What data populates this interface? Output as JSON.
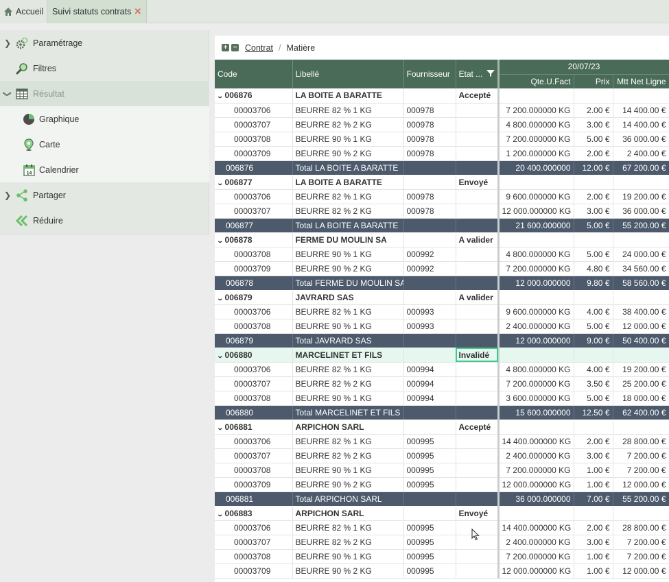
{
  "tabs": {
    "home": "Accueil",
    "active": "Suivi statuts contrats"
  },
  "sidebar": {
    "parametrage": "Paramétrage",
    "filtres": "Filtres",
    "resultat": "Résultat",
    "graphique": "Graphique",
    "carte": "Carte",
    "calendrier": "Calendrier",
    "partager": "Partager",
    "reduire": "Réduire"
  },
  "breadcrumb": {
    "contrat": "Contrat",
    "separator": "/",
    "matiere": "Matière"
  },
  "grid": {
    "headers": {
      "code": "Code",
      "libelle": "Libellé",
      "fournisseur": "Fournisseur",
      "etat": "Etat ...",
      "date": "20/07/23",
      "qte": "Qte.U.Fact",
      "prix": "Prix",
      "mtt": "Mtt Net Ligne"
    },
    "rows": [
      {
        "type": "grp",
        "code": "006876",
        "libelle": "LA BOITE A BARATTE",
        "fournisseur": "",
        "etat": "Accepté",
        "qte": "",
        "prix": "",
        "mtt": ""
      },
      {
        "type": "det",
        "code": "00003706",
        "libelle": "BEURRE 82 % 1 KG",
        "fournisseur": "000978",
        "etat": "",
        "qte": "7 200.000000 KG",
        "prix": "2.00 €",
        "mtt": "14 400.00 €"
      },
      {
        "type": "det",
        "code": "00003707",
        "libelle": "BEURRE 82 % 2 KG",
        "fournisseur": "000978",
        "etat": "",
        "qte": "4 800.000000 KG",
        "prix": "3.00 €",
        "mtt": "14 400.00 €"
      },
      {
        "type": "det",
        "code": "00003708",
        "libelle": "BEURRE 90 % 1 KG",
        "fournisseur": "000978",
        "etat": "",
        "qte": "7 200.000000 KG",
        "prix": "5.00 €",
        "mtt": "36 000.00 €"
      },
      {
        "type": "det",
        "code": "00003709",
        "libelle": "BEURRE 90 % 2 KG",
        "fournisseur": "000978",
        "etat": "",
        "qte": "1 200.000000 KG",
        "prix": "2.00 €",
        "mtt": "2 400.00 €"
      },
      {
        "type": "tot",
        "code": "006876",
        "libelle": "Total LA BOITE A BARATTE",
        "fournisseur": "",
        "etat": "",
        "qte": "20 400.000000",
        "prix": "12.00 €",
        "mtt": "67 200.00 €"
      },
      {
        "type": "grp",
        "code": "006877",
        "libelle": "LA BOITE A BARATTE",
        "fournisseur": "",
        "etat": "Envoyé",
        "qte": "",
        "prix": "",
        "mtt": ""
      },
      {
        "type": "det",
        "code": "00003706",
        "libelle": "BEURRE 82 % 1 KG",
        "fournisseur": "000978",
        "etat": "",
        "qte": "9 600.000000 KG",
        "prix": "2.00 €",
        "mtt": "19 200.00 €"
      },
      {
        "type": "det",
        "code": "00003707",
        "libelle": "BEURRE 82 % 2 KG",
        "fournisseur": "000978",
        "etat": "",
        "qte": "12 000.000000 KG",
        "prix": "3.00 €",
        "mtt": "36 000.00 €"
      },
      {
        "type": "tot",
        "code": "006877",
        "libelle": "Total LA BOITE A BARATTE",
        "fournisseur": "",
        "etat": "",
        "qte": "21 600.000000",
        "prix": "5.00 €",
        "mtt": "55 200.00 €"
      },
      {
        "type": "grp",
        "code": "006878",
        "libelle": "FERME DU MOULIN SA",
        "fournisseur": "",
        "etat": "A valider",
        "qte": "",
        "prix": "",
        "mtt": ""
      },
      {
        "type": "det",
        "code": "00003708",
        "libelle": "BEURRE 90 % 1 KG",
        "fournisseur": "000992",
        "etat": "",
        "qte": "4 800.000000 KG",
        "prix": "5.00 €",
        "mtt": "24 000.00 €"
      },
      {
        "type": "det",
        "code": "00003709",
        "libelle": "BEURRE 90 % 2 KG",
        "fournisseur": "000992",
        "etat": "",
        "qte": "7 200.000000 KG",
        "prix": "4.80 €",
        "mtt": "34 560.00 €"
      },
      {
        "type": "tot",
        "code": "006878",
        "libelle": "Total FERME DU MOULIN SA",
        "fournisseur": "",
        "etat": "",
        "qte": "12 000.000000",
        "prix": "9.80 €",
        "mtt": "58 560.00 €"
      },
      {
        "type": "grp",
        "code": "006879",
        "libelle": "JAVRARD SAS",
        "fournisseur": "",
        "etat": "A valider",
        "qte": "",
        "prix": "",
        "mtt": ""
      },
      {
        "type": "det",
        "code": "00003706",
        "libelle": "BEURRE 82 % 1 KG",
        "fournisseur": "000993",
        "etat": "",
        "qte": "9 600.000000 KG",
        "prix": "4.00 €",
        "mtt": "38 400.00 €"
      },
      {
        "type": "det",
        "code": "00003708",
        "libelle": "BEURRE 90 % 1 KG",
        "fournisseur": "000993",
        "etat": "",
        "qte": "2 400.000000 KG",
        "prix": "5.00 €",
        "mtt": "12 000.00 €"
      },
      {
        "type": "tot",
        "code": "006879",
        "libelle": "Total JAVRARD SAS",
        "fournisseur": "",
        "etat": "",
        "qte": "12 000.000000",
        "prix": "9.00 €",
        "mtt": "50 400.00 €"
      },
      {
        "type": "grp",
        "code": "006880",
        "libelle": "MARCELINET ET FILS",
        "fournisseur": "",
        "etat": "Invalidé",
        "qte": "",
        "prix": "",
        "mtt": "",
        "highlight": true
      },
      {
        "type": "det",
        "code": "00003706",
        "libelle": "BEURRE 82 % 1 KG",
        "fournisseur": "000994",
        "etat": "",
        "qte": "4 800.000000 KG",
        "prix": "4.00 €",
        "mtt": "19 200.00 €"
      },
      {
        "type": "det",
        "code": "00003707",
        "libelle": "BEURRE 82 % 2 KG",
        "fournisseur": "000994",
        "etat": "",
        "qte": "7 200.000000 KG",
        "prix": "3.50 €",
        "mtt": "25 200.00 €"
      },
      {
        "type": "det",
        "code": "00003708",
        "libelle": "BEURRE 90 % 1 KG",
        "fournisseur": "000994",
        "etat": "",
        "qte": "3 600.000000 KG",
        "prix": "5.00 €",
        "mtt": "18 000.00 €"
      },
      {
        "type": "tot",
        "code": "006880",
        "libelle": "Total MARCELINET ET FILS",
        "fournisseur": "",
        "etat": "",
        "qte": "15 600.000000",
        "prix": "12.50 €",
        "mtt": "62 400.00 €"
      },
      {
        "type": "grp",
        "code": "006881",
        "libelle": "ARPICHON SARL",
        "fournisseur": "",
        "etat": "Accepté",
        "qte": "",
        "prix": "",
        "mtt": ""
      },
      {
        "type": "det",
        "code": "00003706",
        "libelle": "BEURRE 82 % 1 KG",
        "fournisseur": "000995",
        "etat": "",
        "qte": "14 400.000000 KG",
        "prix": "2.00 €",
        "mtt": "28 800.00 €"
      },
      {
        "type": "det",
        "code": "00003707",
        "libelle": "BEURRE 82 % 2 KG",
        "fournisseur": "000995",
        "etat": "",
        "qte": "2 400.000000 KG",
        "prix": "3.00 €",
        "mtt": "7 200.00 €"
      },
      {
        "type": "det",
        "code": "00003708",
        "libelle": "BEURRE 90 % 1 KG",
        "fournisseur": "000995",
        "etat": "",
        "qte": "7 200.000000 KG",
        "prix": "1.00 €",
        "mtt": "7 200.00 €"
      },
      {
        "type": "det",
        "code": "00003709",
        "libelle": "BEURRE 90 % 2 KG",
        "fournisseur": "000995",
        "etat": "",
        "qte": "12 000.000000 KG",
        "prix": "1.00 €",
        "mtt": "12 000.00 €"
      },
      {
        "type": "tot",
        "code": "006881",
        "libelle": "Total ARPICHON SARL",
        "fournisseur": "",
        "etat": "",
        "qte": "36 000.000000",
        "prix": "7.00 €",
        "mtt": "55 200.00 €"
      },
      {
        "type": "grp",
        "code": "006883",
        "libelle": "ARPICHON SARL",
        "fournisseur": "",
        "etat": "Envoyé",
        "qte": "",
        "prix": "",
        "mtt": ""
      },
      {
        "type": "det",
        "code": "00003706",
        "libelle": "BEURRE 82 % 1 KG",
        "fournisseur": "000995",
        "etat": "",
        "qte": "14 400.000000 KG",
        "prix": "2.00 €",
        "mtt": "28 800.00 €"
      },
      {
        "type": "det",
        "code": "00003707",
        "libelle": "BEURRE 82 % 2 KG",
        "fournisseur": "000995",
        "etat": "",
        "qte": "2 400.000000 KG",
        "prix": "3.00 €",
        "mtt": "7 200.00 €"
      },
      {
        "type": "det",
        "code": "00003708",
        "libelle": "BEURRE 90 % 1 KG",
        "fournisseur": "000995",
        "etat": "",
        "qte": "7 200.000000 KG",
        "prix": "1.00 €",
        "mtt": "7 200.00 €"
      },
      {
        "type": "det",
        "code": "00003709",
        "libelle": "BEURRE 90 % 2 KG",
        "fournisseur": "000995",
        "etat": "",
        "qte": "12 000.000000 KG",
        "prix": "1.00 €",
        "mtt": "12 000.00 €"
      }
    ]
  },
  "colors": {
    "header_bg": "#4a6b58",
    "total_bg": "#4c5a6c",
    "accent": "#3ec98f",
    "close": "#e06b5c"
  }
}
